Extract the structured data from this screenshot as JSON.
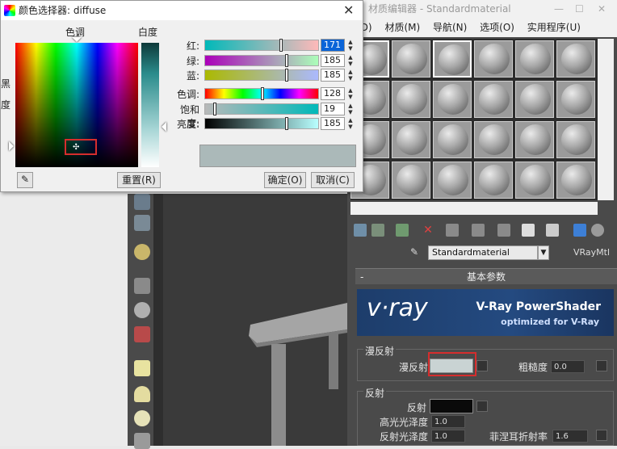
{
  "material_editor": {
    "title": "材质编辑器 - Standardmaterial",
    "menu": [
      "式(D)",
      "材质(M)",
      "导航(N)",
      "选项(O)",
      "实用程序(U)"
    ],
    "material_name": "Standardmaterial",
    "material_type": "VRayMtl",
    "rollout_title": "基本参数",
    "vray_logo": "v·ray",
    "vray_title": "V-Ray PowerShader",
    "vray_subtitle": "optimized for V-Ray",
    "diffuse_group": "漫反射",
    "diffuse_label": "漫反射",
    "roughness_label": "粗糙度",
    "roughness_value": "0.0",
    "reflection_group": "反射",
    "reflection_label": "反射",
    "hilight_gloss_label": "高光光泽度",
    "hilight_gloss_value": "1.0",
    "refl_gloss_label": "反射光泽度",
    "refl_gloss_value": "1.0",
    "fresnel_label": "菲涅耳折射率",
    "fresnel_value": "1.6"
  },
  "picker": {
    "title": "颜色选择器: diffuse",
    "hue_label": "色调",
    "white_label": "白度",
    "black_label": "黑",
    "degree_label": "度",
    "sliders": [
      {
        "label": "红:",
        "value": "171",
        "frac": 0.67
      },
      {
        "label": "绿:",
        "value": "185",
        "frac": 0.72
      },
      {
        "label": "蓝:",
        "value": "185",
        "frac": 0.72
      },
      {
        "label": "色调:",
        "value": "128",
        "frac": 0.5
      },
      {
        "label": "饱和度:",
        "value": "19",
        "frac": 0.07
      },
      {
        "label": "亮度:",
        "value": "185",
        "frac": 0.72
      }
    ],
    "reset_label": "重置(R)",
    "ok_label": "确定(O)",
    "cancel_label": "取消(C)",
    "preview_color": "#abb9b9"
  }
}
